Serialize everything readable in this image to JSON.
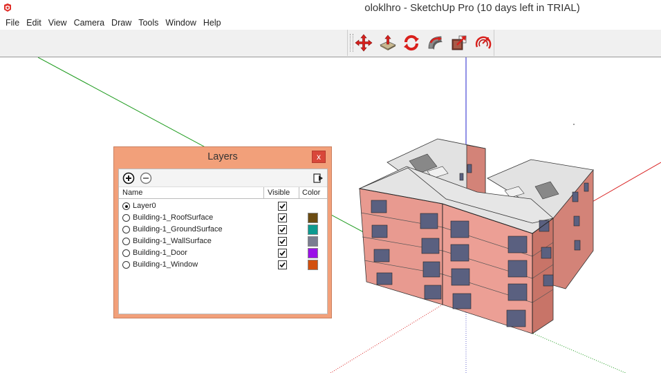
{
  "window": {
    "title": "oloklhro - SketchUp Pro (10 days left in TRIAL)",
    "icon": "sketchup-logo-icon"
  },
  "menubar": {
    "items": [
      {
        "label": "File"
      },
      {
        "label": "Edit"
      },
      {
        "label": "View"
      },
      {
        "label": "Camera"
      },
      {
        "label": "Draw"
      },
      {
        "label": "Tools"
      },
      {
        "label": "Window"
      },
      {
        "label": "Help"
      }
    ]
  },
  "toolbar": {
    "tools": [
      "move-icon",
      "push-pull-icon",
      "rotate-icon",
      "follow-me-icon",
      "scale-icon",
      "offset-icon"
    ]
  },
  "layers_dialog": {
    "title": "Layers",
    "close_label": "x",
    "columns": {
      "name": "Name",
      "visible": "Visible",
      "color": "Color"
    },
    "rows": [
      {
        "name": "Layer0",
        "active": true,
        "visible": true,
        "color": ""
      },
      {
        "name": "Building-1_RoofSurface",
        "active": false,
        "visible": true,
        "color": "#6b4c12"
      },
      {
        "name": "Building-1_GroundSurface",
        "active": false,
        "visible": true,
        "color": "#0d9a90"
      },
      {
        "name": "Building-1_WallSurface",
        "active": false,
        "visible": true,
        "color": "#7a7d90"
      },
      {
        "name": "Building-1_Door",
        "active": false,
        "visible": true,
        "color": "#9b11e8"
      },
      {
        "name": "Building-1_Window",
        "active": false,
        "visible": true,
        "color": "#d2500f"
      }
    ]
  },
  "colors": {
    "dialog_bg": "#f2a07a",
    "close_button": "#d9473a",
    "wall": "#e89a90",
    "roof": "#e4e4e4",
    "axis_red": "#d92020",
    "axis_green": "#1c9a1c",
    "axis_blue": "#2222cc"
  }
}
